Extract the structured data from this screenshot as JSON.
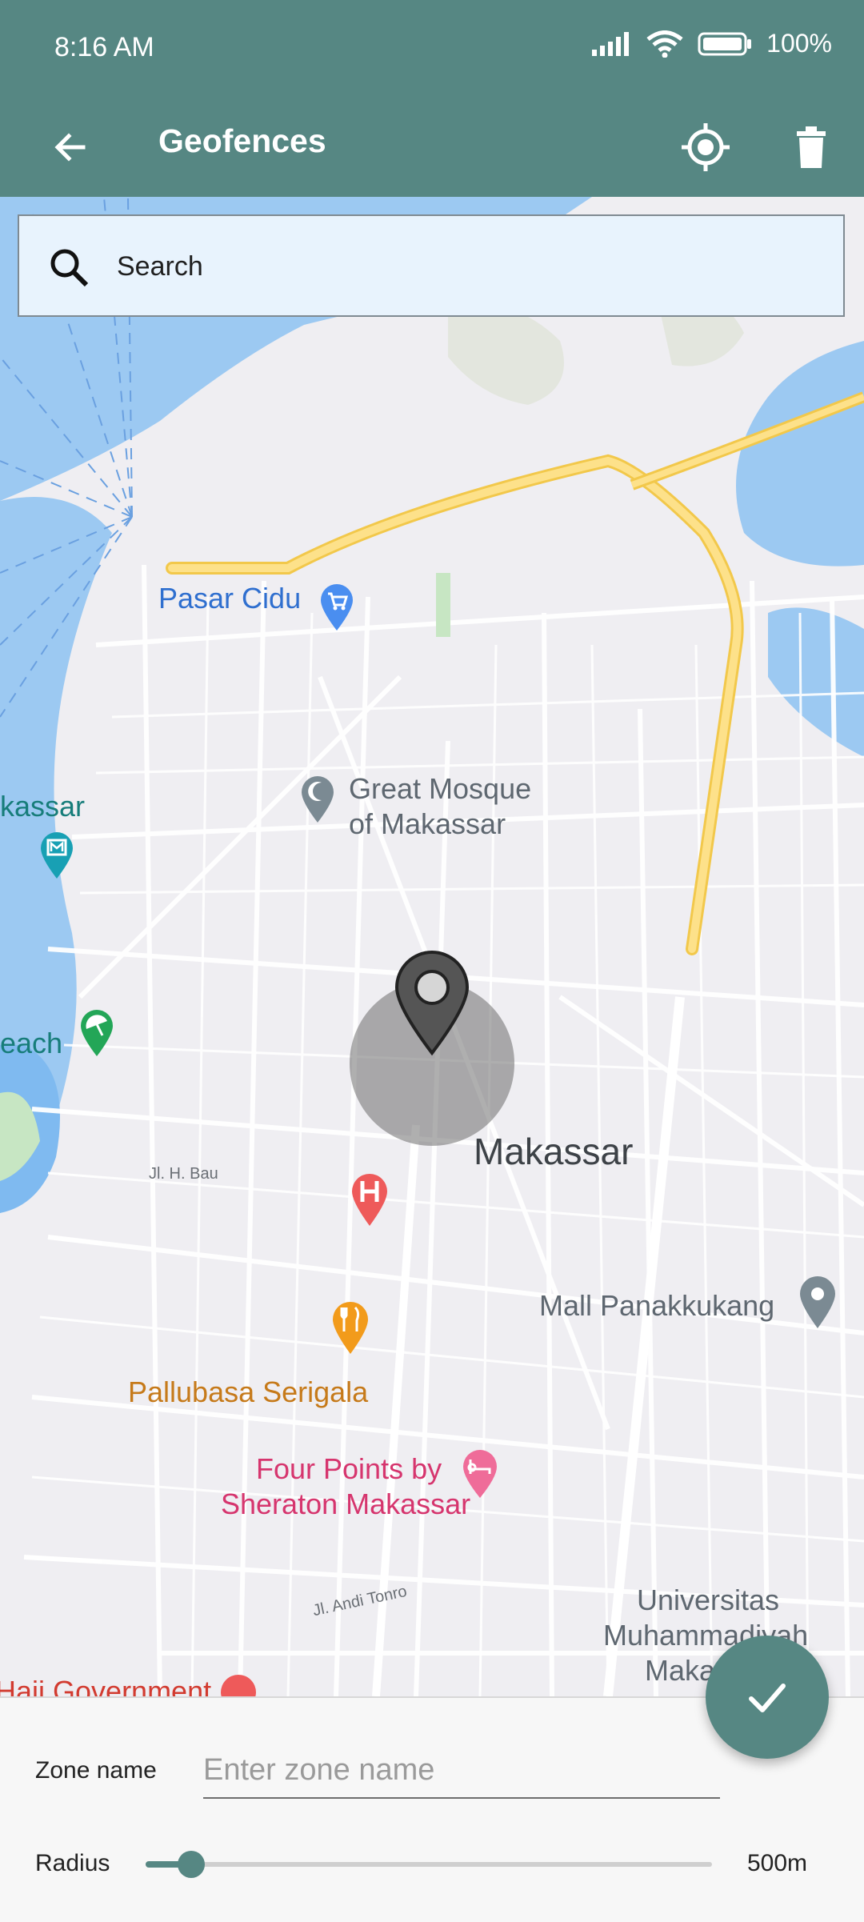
{
  "status": {
    "time": "8:16 AM",
    "battery": "100%"
  },
  "appbar": {
    "title": "Geofences"
  },
  "search": {
    "placeholder": "Search"
  },
  "map": {
    "city": "Makassar",
    "pois": {
      "pasar_cidu": "Pasar Cidu",
      "mosque_line1": "Great Mosque",
      "mosque_line2": "of Makassar",
      "kassar_partial": "kassar",
      "beach_partial": "each",
      "mall": "Mall Panakkukang",
      "pallubasa": "Pallubasa Serigala",
      "four_points_line1": "Four Points by",
      "four_points_line2": "Sheraton Makassar",
      "univ_line1": "Universitas",
      "univ_line2": "Muhammadiyah",
      "univ_line3": "Maka",
      "haji_partial": "Haji Government"
    },
    "streets": {
      "bau": "Jl. H. Bau",
      "andi": "Jl. Andi Tonro"
    }
  },
  "panel": {
    "zone_label": "Zone name",
    "zone_placeholder": "Enter zone name",
    "radius_label": "Radius",
    "radius_value": "500m",
    "radius_fraction": 0.08
  },
  "colors": {
    "primary": "#568783",
    "water": "#9cc9f2",
    "highway": "#fde18a"
  },
  "icons": {
    "back": "arrow-back-icon",
    "location": "my-location-icon",
    "delete": "trash-icon",
    "search": "search-icon",
    "confirm": "check-icon",
    "pin": "map-pin-icon"
  }
}
